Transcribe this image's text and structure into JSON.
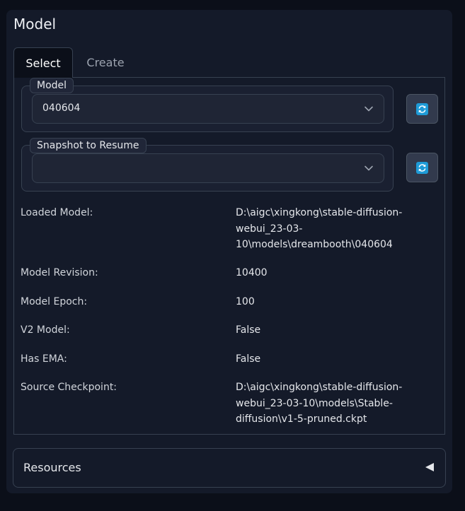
{
  "panel": {
    "title": "Model"
  },
  "tabs": [
    {
      "label": "Select",
      "active": true
    },
    {
      "label": "Create",
      "active": false
    }
  ],
  "model_field": {
    "label": "Model",
    "value": "040604"
  },
  "snapshot_field": {
    "label": "Snapshot to Resume",
    "value": ""
  },
  "info": [
    {
      "label": "Loaded Model:",
      "value": "D:\\aigc\\xingkong\\stable-diffusion-webui_23-03-10\\models\\dreambooth\\040604"
    },
    {
      "label": "Model Revision:",
      "value": "10400"
    },
    {
      "label": "Model Epoch:",
      "value": "100"
    },
    {
      "label": "V2 Model:",
      "value": "False"
    },
    {
      "label": "Has EMA:",
      "value": "False"
    },
    {
      "label": "Source Checkpoint:",
      "value": "D:\\aigc\\xingkong\\stable-diffusion-webui_23-03-10\\models\\Stable-diffusion\\v1-5-pruned.ckpt"
    }
  ],
  "resources": {
    "label": "Resources"
  },
  "icons": {
    "refresh": "refresh-icon",
    "dropdown": "chevron-down-icon",
    "collapse": "triangle-left-icon"
  },
  "colors": {
    "accent": "#1e9bd7",
    "background": "#0b0f19",
    "panel": "#141a29"
  }
}
